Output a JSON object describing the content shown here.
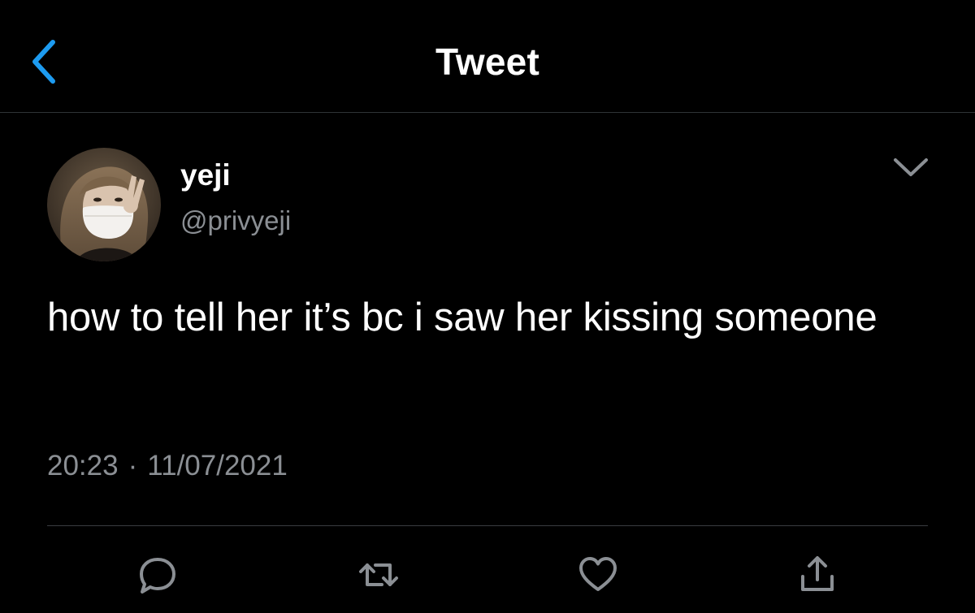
{
  "nav": {
    "title": "Tweet",
    "back_icon": "chevron-left-icon"
  },
  "author": {
    "display_name": "yeji",
    "handle": "@privyeji",
    "avatar_icon": "profile-photo"
  },
  "tweet": {
    "text": "how to tell her it’s bc i saw her kissing someone",
    "time": "20:23",
    "separator": "·",
    "date": "11/07/2021"
  },
  "actions": [
    {
      "name": "reply",
      "icon": "speech-bubble-icon"
    },
    {
      "name": "retweet",
      "icon": "retweet-icon"
    },
    {
      "name": "like",
      "icon": "heart-icon"
    },
    {
      "name": "share",
      "icon": "share-upload-icon"
    }
  ],
  "colors": {
    "background": "#000000",
    "accent": "#1d9bf0",
    "text": "#ffffff",
    "secondary_text": "#8b8f94",
    "divider": "#2f3336"
  }
}
